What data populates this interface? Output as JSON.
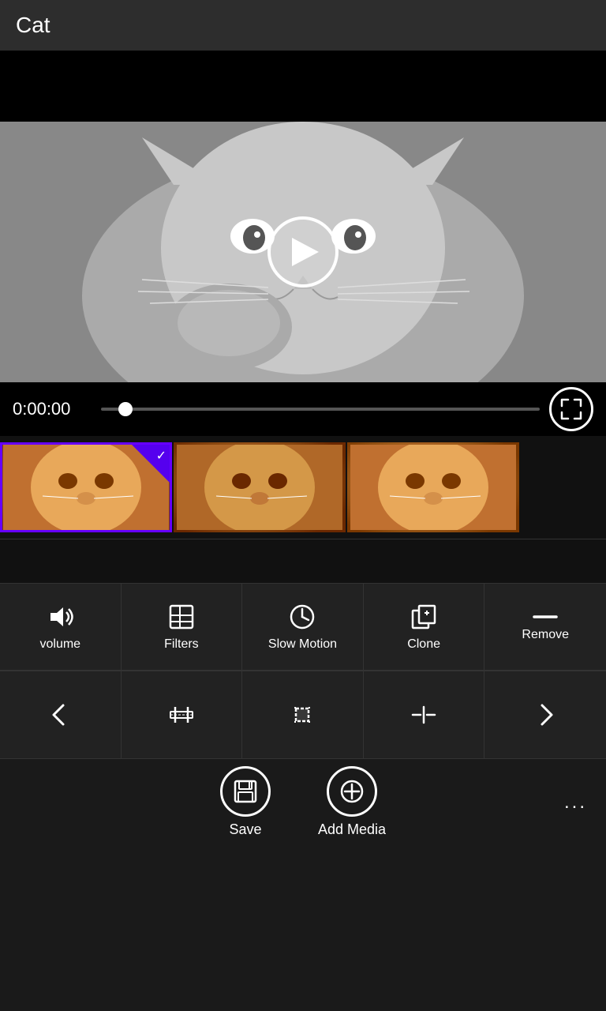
{
  "titleBar": {
    "title": "Cat"
  },
  "timeline": {
    "time": "0:00:00"
  },
  "tools": {
    "row1": [
      {
        "id": "volume",
        "label": "volume"
      },
      {
        "id": "filters",
        "label": "Filters"
      },
      {
        "id": "slow-motion",
        "label": "Slow Motion"
      },
      {
        "id": "clone",
        "label": "Clone"
      },
      {
        "id": "remove",
        "label": "Remove"
      }
    ],
    "row2": [
      {
        "id": "back",
        "label": ""
      },
      {
        "id": "trim",
        "label": ""
      },
      {
        "id": "crop",
        "label": ""
      },
      {
        "id": "split",
        "label": ""
      },
      {
        "id": "forward",
        "label": ""
      }
    ]
  },
  "bottomBar": {
    "saveLabel": "Save",
    "addMediaLabel": "Add Media",
    "moreLabel": "..."
  }
}
